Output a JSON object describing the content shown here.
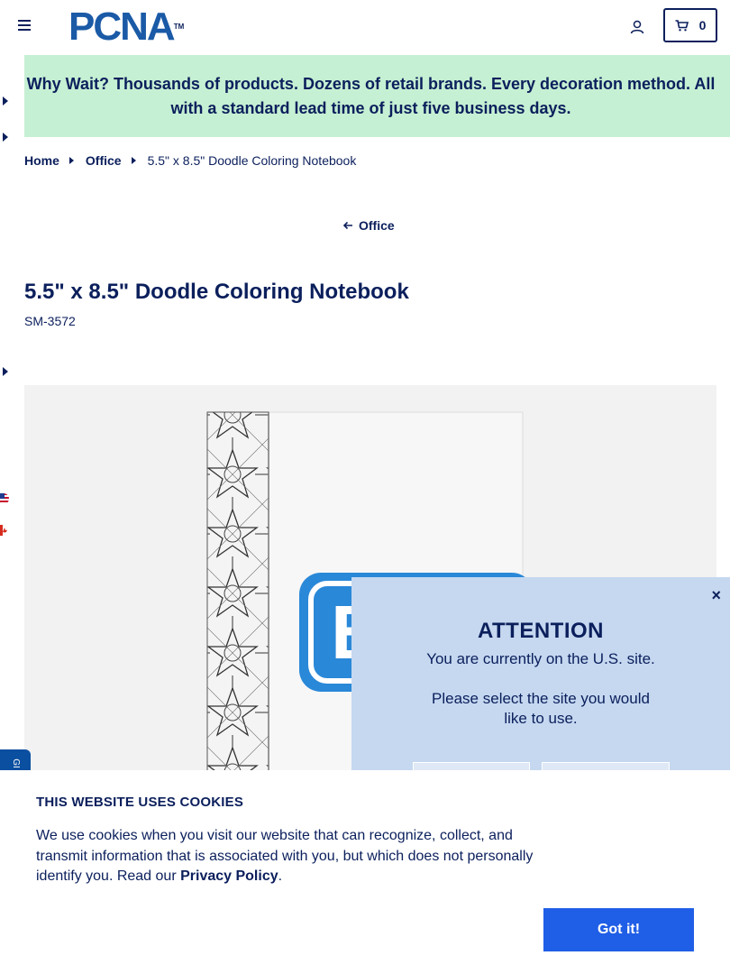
{
  "header": {
    "logo_text": "PCNA",
    "logo_tm": "TM",
    "cart_count": "0"
  },
  "promo": {
    "text": "Why Wait? Thousands of products. Dozens of retail brands. Every decoration method. All with a standard lead time of just five business days."
  },
  "breadcrumb": {
    "home": "Home",
    "category": "Office",
    "current": "5.5\" x 8.5\" Doodle Coloring Notebook"
  },
  "back_link": {
    "label": "Office"
  },
  "product": {
    "title": "5.5\" x 8.5\" Doodle Coloring Notebook",
    "sku": "SM-3572",
    "logo_letter": "B"
  },
  "modal": {
    "heading": "ATTENTION",
    "line1": "You are currently on the U.S. site.",
    "line2": "Please select the site you would like to use.",
    "close": "×"
  },
  "chat": {
    "label": "GI"
  },
  "cookie": {
    "heading": "THIS WEBSITE USES COOKIES",
    "text": "We use cookies when you visit our website that can recognize, collect, and transmit information that is associated with you, but which does not personally identify you. Read our ",
    "link": "Privacy Policy",
    "period": ".",
    "button": "Got it!"
  },
  "colors": {
    "navy": "#0b1f5c",
    "promo_bg": "#c6f0d3",
    "modal_bg": "#c5d8f0",
    "button_blue": "#1f5ee6",
    "logo_blue": "#1a5aa6"
  }
}
